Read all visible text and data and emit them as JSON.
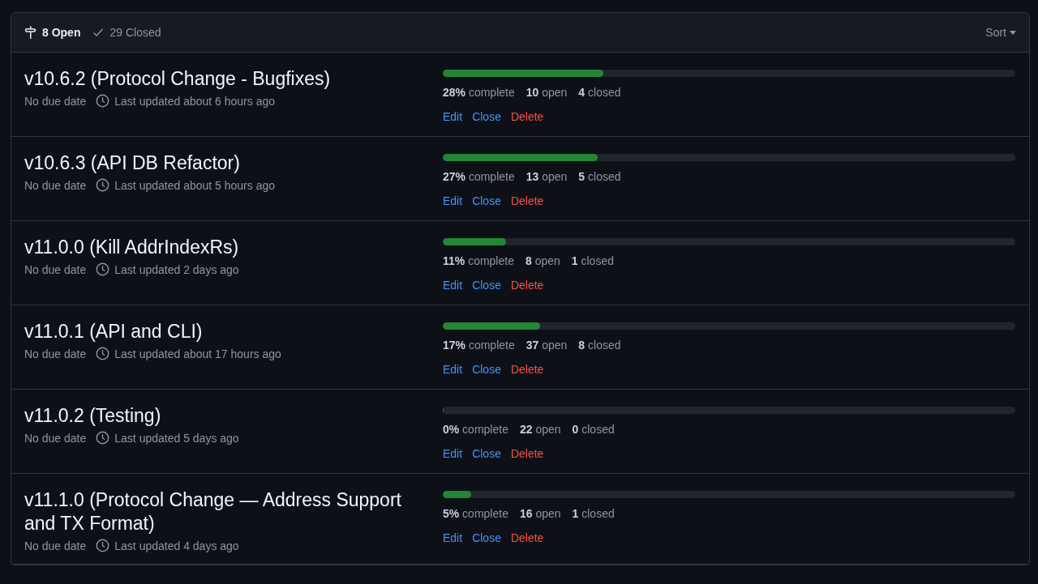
{
  "filters": [
    {
      "kind": "open",
      "label": "8 Open",
      "selected": true
    },
    {
      "kind": "closed",
      "label": "29 Closed",
      "selected": false
    }
  ],
  "sort": {
    "label": "Sort"
  },
  "milestones": [
    {
      "title": "v10.6.2 (Protocol Change - Bugfixes)",
      "due": "No due date",
      "updated": "Last updated about 6 hours ago",
      "level": 0.28,
      "stats": [
        "**28%** complete",
        "**10** open",
        "**4** closed"
      ],
      "actions": [
        {
          "kind": "edit",
          "label": "Edit"
        },
        {
          "kind": "close",
          "label": "Close"
        },
        {
          "kind": "delete",
          "label": "Delete"
        }
      ]
    },
    {
      "title": "v10.6.3 (API DB Refactor)",
      "due": "No due date",
      "updated": "Last updated about 5 hours ago",
      "level": 0.27,
      "stats": [
        "**27%** complete",
        "**13** open",
        "**5** closed"
      ],
      "actions": [
        {
          "kind": "edit",
          "label": "Edit"
        },
        {
          "kind": "close",
          "label": "Close"
        },
        {
          "kind": "delete",
          "label": "Delete"
        }
      ]
    },
    {
      "title": "v11.0.0 (Kill AddrIndexRs)",
      "due": "No due date",
      "updated": "Last updated 2 days ago",
      "level": 0.11,
      "stats": [
        "**11%** complete",
        "**8** open",
        "**1** closed"
      ],
      "actions": [
        {
          "kind": "edit",
          "label": "Edit"
        },
        {
          "kind": "close",
          "label": "Close"
        },
        {
          "kind": "delete",
          "label": "Delete"
        }
      ]
    },
    {
      "title": "v11.0.1 (API and CLI)",
      "due": "No due date",
      "updated": "Last updated about 17 hours ago",
      "level": 0.17,
      "stats": [
        "**17%** complete",
        "**37** open",
        "**8** closed"
      ],
      "actions": [
        {
          "kind": "edit",
          "label": "Edit"
        },
        {
          "kind": "close",
          "label": "Close"
        },
        {
          "kind": "delete",
          "label": "Delete"
        }
      ]
    },
    {
      "title": "v11.0.2 (Testing)",
      "due": "No due date",
      "updated": "Last updated 5 days ago",
      "level": 0,
      "stats": [
        "**0%** complete",
        "**22** open",
        "**0** closed"
      ],
      "actions": [
        {
          "kind": "edit",
          "label": "Edit"
        },
        {
          "kind": "close",
          "label": "Close"
        },
        {
          "kind": "delete",
          "label": "Delete"
        }
      ]
    },
    {
      "title": "v11.1.0 (Protocol Change — Address Support and TX Format)",
      "due": "No due date",
      "updated": "Last updated 4 days ago",
      "level": 0.05,
      "stats": [
        "**5%** complete",
        "**16** open",
        "**1** closed"
      ],
      "actions": [
        {
          "kind": "edit",
          "label": "Edit"
        },
        {
          "kind": "close",
          "label": "Close"
        },
        {
          "kind": "delete",
          "label": "Delete"
        }
      ]
    }
  ]
}
